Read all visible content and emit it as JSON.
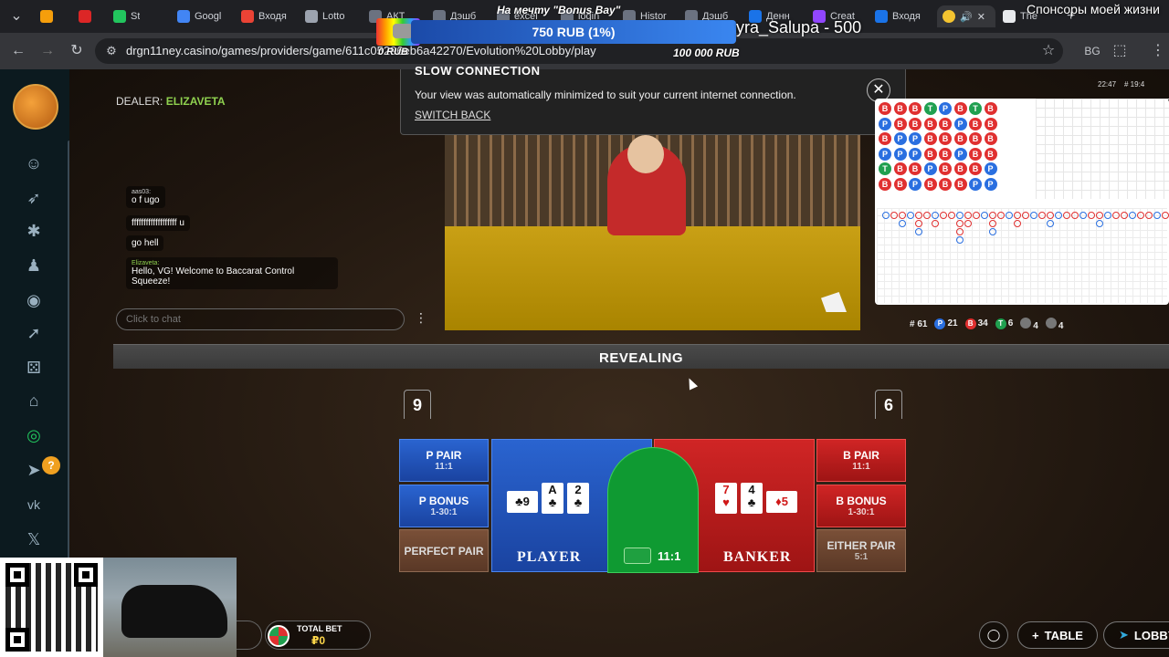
{
  "browser": {
    "tabs": [
      {
        "label": "St",
        "color": "#22c55e"
      },
      {
        "label": "Googl",
        "color": "#4285f4"
      },
      {
        "label": "Входя",
        "color": "#ea4335"
      },
      {
        "label": "Lotto",
        "color": "#9ca3af"
      },
      {
        "label": "АКТ",
        "color": "#6b7280"
      },
      {
        "label": "Дэшб",
        "color": "#6b7280"
      },
      {
        "label": "excel",
        "color": "#6b7280"
      },
      {
        "label": "login",
        "color": "#6b7280"
      },
      {
        "label": "Histor",
        "color": "#6b7280"
      },
      {
        "label": "Дэшб",
        "color": "#6b7280"
      },
      {
        "label": "Денн",
        "color": "#1a73e8"
      },
      {
        "label": "Creat",
        "color": "#9146ff"
      },
      {
        "label": "Входя",
        "color": "#1a73e8"
      },
      {
        "label": "The",
        "color": "#e8eaed"
      }
    ],
    "url": "drgn11ney.casino/games/providers/game/611c05",
    "url_suffix": "296eb6a42270/Evolution%20Lobby/play",
    "extension_badge": "BG"
  },
  "stream_overlay": {
    "title": "На мечту \"Bonus Bay\"",
    "progress_text": "750 RUB (1%)",
    "progress_fraction": 0.01,
    "left_amount": "0 RUB",
    "right_amount": "100 000 RUB",
    "sponsor": "Спонсоры моей жизни",
    "donor": "yra_Salupa - 500"
  },
  "slow_connection": {
    "title": "SLOW CONNECTION",
    "message": "Your view was automatically minimized to suit your current internet connection.",
    "link": "SWITCH BACK"
  },
  "dealer": {
    "label": "DEALER:",
    "name": "ELIZAVETA"
  },
  "chat": {
    "messages": [
      {
        "user": "aas03:",
        "text": "o f ugo"
      },
      {
        "user": "",
        "text": "fffffffffffffffffff u"
      },
      {
        "user": "",
        "text": "go hell"
      },
      {
        "user": "Elizaveta:",
        "text": "Hello, VG! Welcome to Baccarat Control Squeeze!"
      }
    ],
    "input_placeholder": "Click to chat"
  },
  "clock": "22:47",
  "clock_suffix": "# 19:4",
  "stats": {
    "hands": "# 61",
    "player_wins": "21",
    "banker_wins": "34",
    "ties": "6",
    "player_pairs": "4",
    "banker_pairs": "4",
    "p_label": "P",
    "b_label": "B",
    "t_label": "T"
  },
  "status": "REVEALING",
  "scores": {
    "player": "9",
    "banker": "6"
  },
  "bets": {
    "p_pair": {
      "label": "P PAIR",
      "odds": "11:1"
    },
    "p_bonus": {
      "label": "P BONUS",
      "odds": "1-30:1"
    },
    "perfect_pair": {
      "label": "PERFECT PAIR",
      "odds": ""
    },
    "player": {
      "label": "PLAYER"
    },
    "tie": {
      "odds": "11:1"
    },
    "banker": {
      "label": "BANKER"
    },
    "b_pair": {
      "label": "B PAIR",
      "odds": "11:1"
    },
    "b_bonus": {
      "label": "B BONUS",
      "odds": "1-30:1"
    },
    "either_pair": {
      "label": "EITHER PAIR",
      "odds": "5:1"
    }
  },
  "player_cards": [
    {
      "rank": "9",
      "suit": "♣",
      "color": "black",
      "sideways": true
    },
    {
      "rank": "A",
      "suit": "♣",
      "color": "black",
      "sideways": false
    },
    {
      "rank": "2",
      "suit": "♣",
      "color": "black",
      "sideways": false
    }
  ],
  "banker_cards": [
    {
      "rank": "7",
      "suit": "♥",
      "color": "red",
      "sideways": false
    },
    {
      "rank": "4",
      "suit": "♣",
      "color": "black",
      "sideways": false
    },
    {
      "rank": "5",
      "suit": "♦",
      "color": "red",
      "sideways": true
    }
  ],
  "total_bet": {
    "label": "TOTAL BET",
    "value": "₽0"
  },
  "bottom_buttons": {
    "table": "TABLE",
    "lobby": "LOBBY"
  },
  "bead_road": [
    "B",
    "P",
    "B",
    "P",
    "T",
    "B",
    "B",
    "B",
    "P",
    "P",
    "B",
    "B",
    "B",
    "B",
    "P",
    "P",
    "B",
    "P",
    "T",
    "B",
    "B",
    "B",
    "P",
    "B",
    "P",
    "B",
    "B",
    "B",
    "B",
    "B",
    "B",
    "P",
    "B",
    "P",
    "B",
    "B",
    "T",
    "B",
    "B",
    "B",
    "B",
    "P",
    "B",
    "B",
    "B",
    "B",
    "P",
    "P"
  ],
  "colors": {
    "player": "#2a6fe0",
    "banker": "#e03030",
    "tie": "#20a050"
  }
}
